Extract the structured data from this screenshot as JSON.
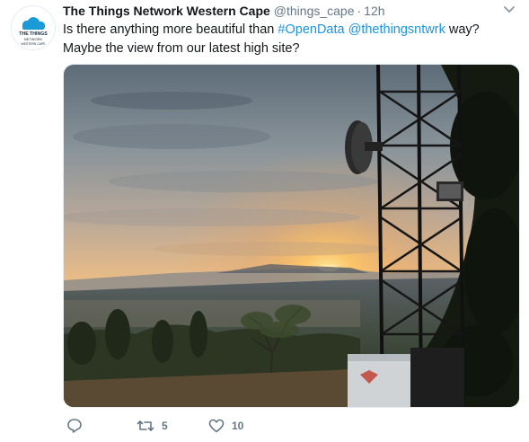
{
  "tweet": {
    "author_name": "The Things Network Western Cape",
    "handle": "@things_cape",
    "separator": "·",
    "time": "12h",
    "text_part1": "Is there anything more beautiful than ",
    "hashtag": "#OpenData",
    "mention": "@thethingsntwrk",
    "text_part2": "  way? Maybe the view from our latest high site?",
    "avatar": {
      "line1": "THE THINGS",
      "line2": "NETWORK",
      "line3": "WESTERN CAPE",
      "icon": "cloud-icon"
    },
    "media": {
      "alt": "sunset view from tower with antenna"
    },
    "actions": {
      "reply": {
        "icon": "reply-icon",
        "count": ""
      },
      "retweet": {
        "icon": "retweet-icon",
        "count": "5"
      },
      "like": {
        "icon": "heart-icon",
        "count": "10"
      }
    }
  },
  "colors": {
    "link": "#1b95e0",
    "muted": "#657786",
    "text": "#14171a",
    "brand": "#1a9ad6"
  }
}
